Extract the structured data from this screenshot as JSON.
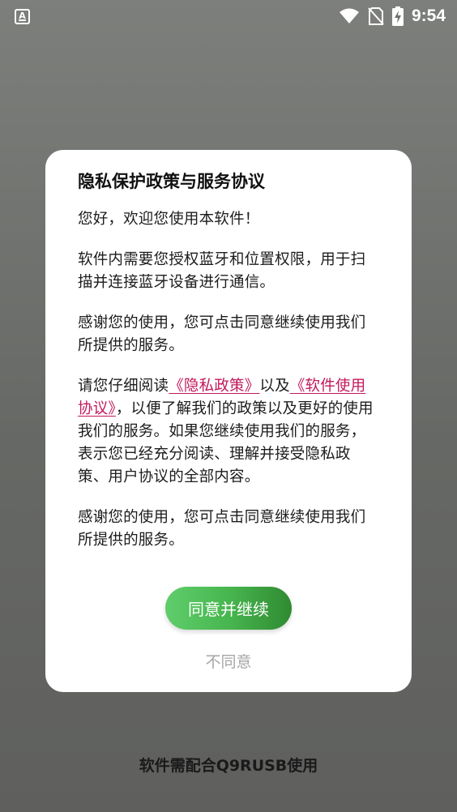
{
  "status_bar": {
    "time": "9:54",
    "notification_icon": "a-app-icon",
    "wifi_icon": "wifi-icon",
    "sim_icon": "no-sim-icon",
    "battery_icon": "battery-charging-icon"
  },
  "dialog": {
    "title": "隐私保护政策与服务协议",
    "greeting": "您好，欢迎您使用本软件！",
    "permissions_text": "软件内需要您授权蓝牙和位置权限，用于扫描并连接蓝牙设备进行通信。",
    "thanks_1": "感谢您的使用，您可点击同意继续使用我们所提供的服务。",
    "read_prefix": "请您仔细阅读",
    "privacy_link": "《隐私政策》",
    "read_and": "以及",
    "terms_link": "《软件使用协议》",
    "read_suffix": "，以便了解我们的政策以及更好的使用我们的服务。如果您继续使用我们的服务，表示您已经充分阅读、理解并接受隐私政策、用户协议的全部内容。",
    "thanks_2": "感谢您的使用，您可点击同意继续使用我们所提供的服务。",
    "agree_button": "同意并继续",
    "disagree_button": "不同意"
  },
  "footer": {
    "note": "软件需配合Q9RUSB使用"
  },
  "colors": {
    "link": "#c2185b",
    "agree_gradient_start": "#5fcd6b",
    "agree_gradient_end": "#2f8a32",
    "disagree_text": "#a6a6a6"
  }
}
